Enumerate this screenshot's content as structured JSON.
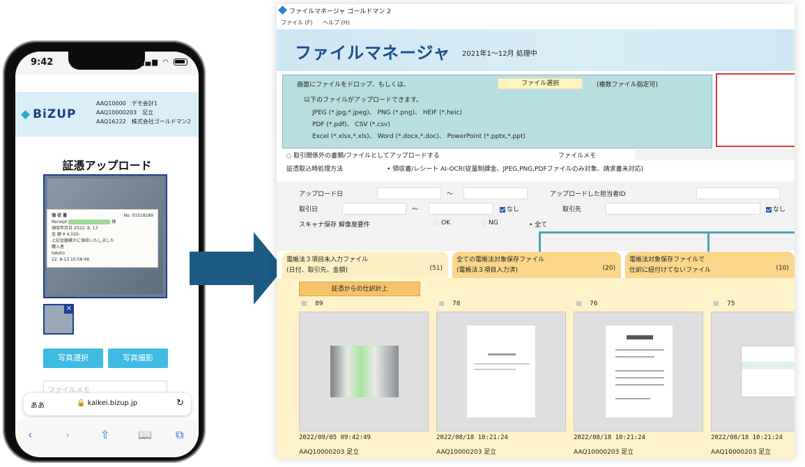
{
  "phone": {
    "time": "9:42",
    "logo": "BiZUP",
    "accounts": [
      "AAQ10000　デモ会計1",
      "AAQ10000203　足立",
      "AAQ16222　株式会社ゴールドマン2"
    ],
    "title": "証憑アップロード",
    "receipt_lines": [
      "領 収 書",
      "No. 01518289",
      "Receipt",
      "様",
      "領収年月日 2022. 8. 13",
      "金 額 ¥ 4,020-",
      "上記金額確かに領収いたしました",
      "購入者",
      "teketo",
      "22. 8-13 10:58:48"
    ],
    "thumb_close": "×",
    "btn_select": "写真選択",
    "btn_camera": "写真撮影",
    "memo_placeholder": "ファイルメモ",
    "url_aa": "ああ",
    "url": "🔒 kaikei.bizup.jp",
    "url_reload": "↻",
    "toolbar": [
      "‹",
      "›",
      "⇧",
      "📖",
      "⧉"
    ]
  },
  "app": {
    "window_title": "ファイルマネージャ ゴールドマン 2",
    "menu": [
      "ファイル (F)",
      "ヘルプ (H)"
    ],
    "banner_title": "ファイルマネージャ",
    "banner_sub": "2021年1〜12月 処理中",
    "drop": {
      "line1": "画面にファイルをドロップ、もしくは、",
      "file_button": "ファイル選択",
      "multi": "(複数ファイル指定可)",
      "line2": "以下のファイルがアップロードできます。",
      "types": [
        "JPEG (*.jpg,*.jpeg)、 PNG (*.png)、 HEIF (*.heic)",
        "PDF (*.pdf)、 CSV (*.csv)",
        "Excel (*.xlsx,*.xls)、 Word (*.docx,*.doc)、 PowerPoint (*.pptx,*.ppt)"
      ]
    },
    "nontx_label": "取引関係外の書類/ファイルとしてアップロードする",
    "memo_label": "ファイルメモ",
    "method_label": "証憑取込時処理方法",
    "method_value": "• 領収書/レシート AI-OCR(従量制課金、JPEG,PNG,PDFファイルのみ対象、請求書未対応)",
    "filters": {
      "upload_date": "アップロード日",
      "tilde": "〜",
      "uploader_id": "アップロードした担当者ID",
      "tx_date": "取引日",
      "none": "なし",
      "partner": "取引先",
      "scanner": "スキャナ保存 解像度要件",
      "ok": "OK",
      "ng": "NG",
      "all": "• 全て"
    },
    "tabs": [
      {
        "line1": "電帳法３項目未入力ファイル",
        "line2": "(日付、取引先、金額)",
        "count": "(51)"
      },
      {
        "line1": "全ての電帳法対象保存ファイル",
        "line2": "(電帳法３項目入力済)",
        "count": "(20)"
      },
      {
        "line1": "電帳法対象保存ファイルで",
        "line2": "仕訳に紐付けてないファイル",
        "count": "(10)"
      }
    ],
    "journal_button": "証憑からの仕訳計上",
    "cards": [
      {
        "num": "89",
        "date": "2022/09/05 09:42:49",
        "who": "AAQ10000203 足立"
      },
      {
        "num": "78",
        "date": "2022/08/18 10:21:24",
        "who": "AAQ10000203 足立"
      },
      {
        "num": "76",
        "date": "2022/08/18 10:21:24",
        "who": "AAQ10000203 足立"
      },
      {
        "num": "75",
        "date": "2022/08/18 10:21:24",
        "who": "AAQ10000203 足立"
      }
    ]
  },
  "colors": {
    "accent": "#3dbbe3",
    "brand": "#1b4b8f",
    "arrow": "#1d5a84",
    "tab": "#fbd78c",
    "pane": "#fdf2c8"
  }
}
